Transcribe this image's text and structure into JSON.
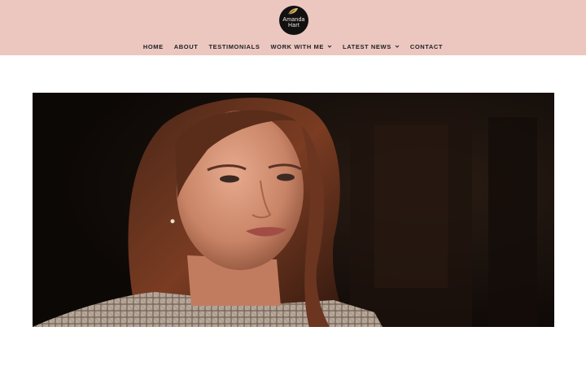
{
  "logo": {
    "line1": "Amanda",
    "line2": "Hart"
  },
  "nav": {
    "home": "HOME",
    "about": "ABOUT",
    "testimonials": "TESTIMONIALS",
    "work_with_me": "WORK WITH ME",
    "latest_news": "LATEST NEWS",
    "contact": "CONTACT"
  },
  "colors": {
    "header_bg": "#ecc7c0",
    "logo_bg": "#111111",
    "nav_text": "#222222"
  },
  "icons": [
    "leaf-icon",
    "chevron-down-icon"
  ],
  "hero": {
    "subject": "portrait-photo"
  }
}
